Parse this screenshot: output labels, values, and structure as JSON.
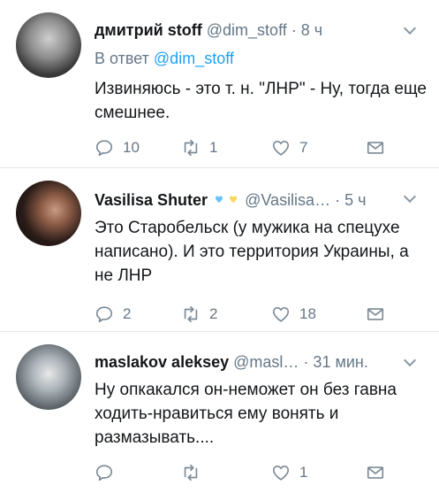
{
  "tweets": [
    {
      "name": "дмитрий  stoff",
      "handle": "@dim_stoff",
      "time": "· 8 ч",
      "reply_prefix": "В ответ",
      "reply_handle": "@dim_stoff",
      "text": "Извиняюсь - это т. н. \"ЛНР\" - Ну, тогда еще смешнее.",
      "counts": {
        "reply": "10",
        "retweet": "1",
        "like": "7"
      }
    },
    {
      "name": "Vasilisa Shuter",
      "handle": "@Vasilisa…",
      "time": "· 5 ч",
      "badge_colors": [
        "#1da1f2",
        "#f5c400"
      ],
      "text": "Это Старобельск (у мужика на спецухе написано). И это территория Украины, а не ЛНР",
      "counts": {
        "reply": "2",
        "retweet": "2",
        "like": "18"
      }
    },
    {
      "name": "maslakov aleksey",
      "handle": "@masl…",
      "time": "· 31 мин.",
      "text": "Ну опкакался он-неможет он без гавна ходить-нравиться ему вонять и размазывать....",
      "counts": {
        "reply": "",
        "retweet": "",
        "like": "1"
      }
    }
  ],
  "icons": {
    "reply": "reply-icon",
    "retweet": "retweet-icon",
    "like": "heart-icon",
    "dm": "mail-icon",
    "menu": "chevron-down-icon"
  },
  "colors": {
    "link": "#1da1f2",
    "muted": "#657786",
    "divider": "#e1e8ed"
  }
}
